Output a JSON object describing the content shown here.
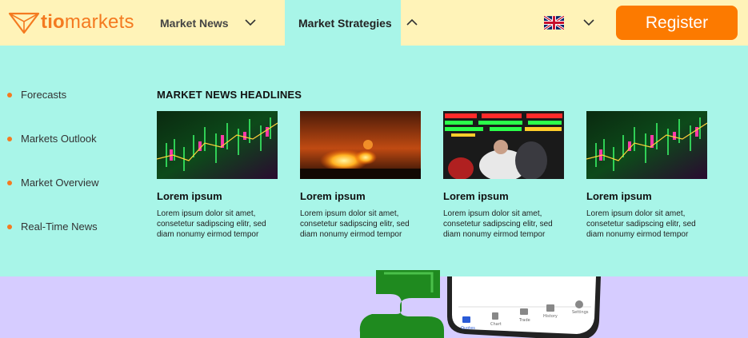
{
  "header": {
    "logo_text_bold": "tio",
    "logo_text_light": "markets",
    "nav": [
      {
        "label": "Market News"
      },
      {
        "label": "Market Strategies"
      }
    ],
    "register_label": "Register"
  },
  "menu": {
    "side_items": [
      "Forecasts",
      "Markets Outlook",
      "Market Overview",
      "Real-Time News"
    ],
    "section_title": "MARKET NEWS HEADLINES",
    "cards": [
      {
        "title": "Lorem ipsum",
        "text": "Lorem ipsum dolor sit amet, consetetur sadipscing elitr, sed diam nonumy eirmod tempor"
      },
      {
        "title": "Lorem ipsum",
        "text": "Lorem ipsum dolor sit amet, consetetur sadipscing elitr, sed diam nonumy eirmod tempor"
      },
      {
        "title": "Lorem ipsum",
        "text": "Lorem ipsum dolor sit amet, consetetur sadipscing elitr, sed diam nonumy eirmod tempor"
      },
      {
        "title": "Lorem ipsum",
        "text": "Lorem ipsum dolor sit amet, consetetur sadipscing elitr, sed diam nonumy eirmod tempor"
      }
    ]
  },
  "phone_tabs": [
    "Quotes",
    "Chart",
    "Trade",
    "History",
    "Settings"
  ],
  "colors": {
    "brand_orange": "#fc7a00",
    "header_bg": "#fff3b8",
    "menu_bg": "#a8f5e8",
    "page_bg": "#d6ccff"
  }
}
